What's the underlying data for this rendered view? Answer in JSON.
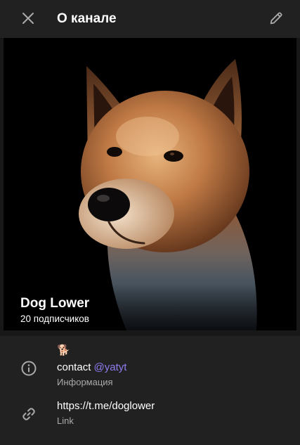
{
  "header": {
    "title": "О канале"
  },
  "channel": {
    "name": "Dog Lower",
    "subscribers": "20 подписчиков"
  },
  "info": {
    "emoji": "🐕",
    "contact_prefix": "contact",
    "contact_handle": "@yatyt",
    "description_label": "Информация",
    "link": "https://t.me/doglower",
    "link_label": "Link"
  },
  "icons": {
    "close": "close-icon",
    "edit": "pencil-icon",
    "info": "info-circle-icon",
    "link": "link-icon"
  },
  "colors": {
    "background": "#181818",
    "panel": "#212121",
    "accent": "#8e7cf0",
    "secondary_text": "#aaaaaa"
  }
}
